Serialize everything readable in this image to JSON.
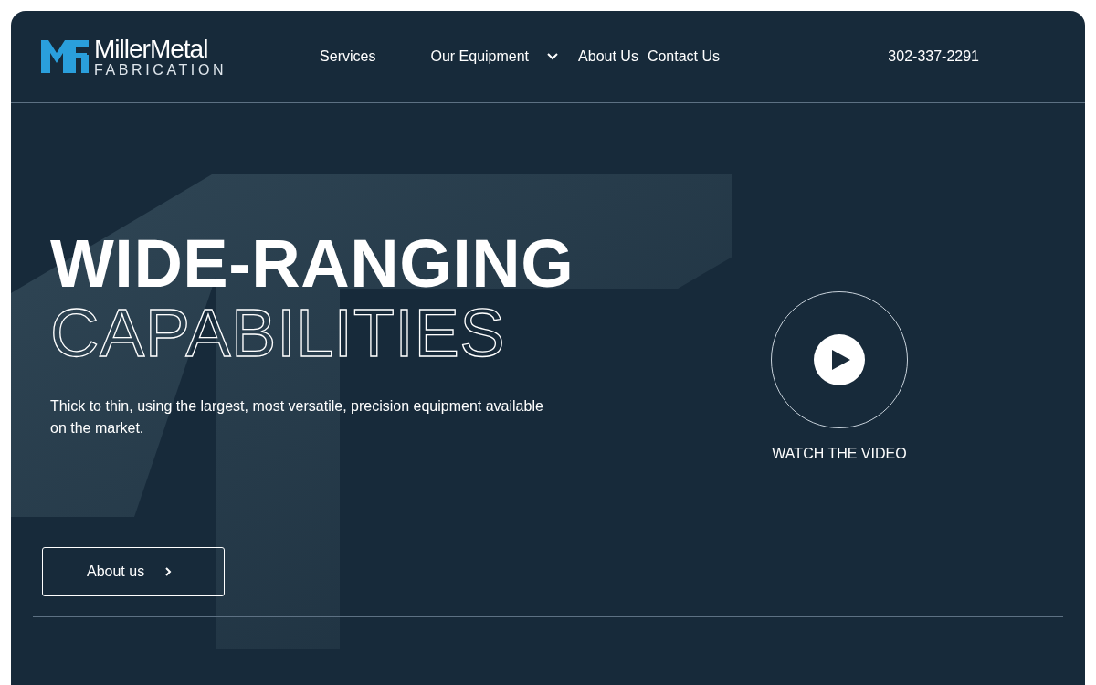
{
  "logo": {
    "name": "MillerMetal",
    "tagline": "FABRICATION"
  },
  "nav": [
    {
      "label": "Services",
      "has_dropdown": false
    },
    {
      "label": "Our Equipment",
      "has_dropdown": true
    },
    {
      "label": "About Us",
      "has_dropdown": false
    },
    {
      "label": "Contact Us",
      "has_dropdown": false
    }
  ],
  "phone": "302-337-2291",
  "hero": {
    "title": "WIDE-RANGING",
    "title_outline": "CAPABILITIES",
    "description": "Thick to thin, using the largest, most versatile, precision equipment available on the market.",
    "button": "About us",
    "video_label": "WATCH THE VIDEO"
  }
}
